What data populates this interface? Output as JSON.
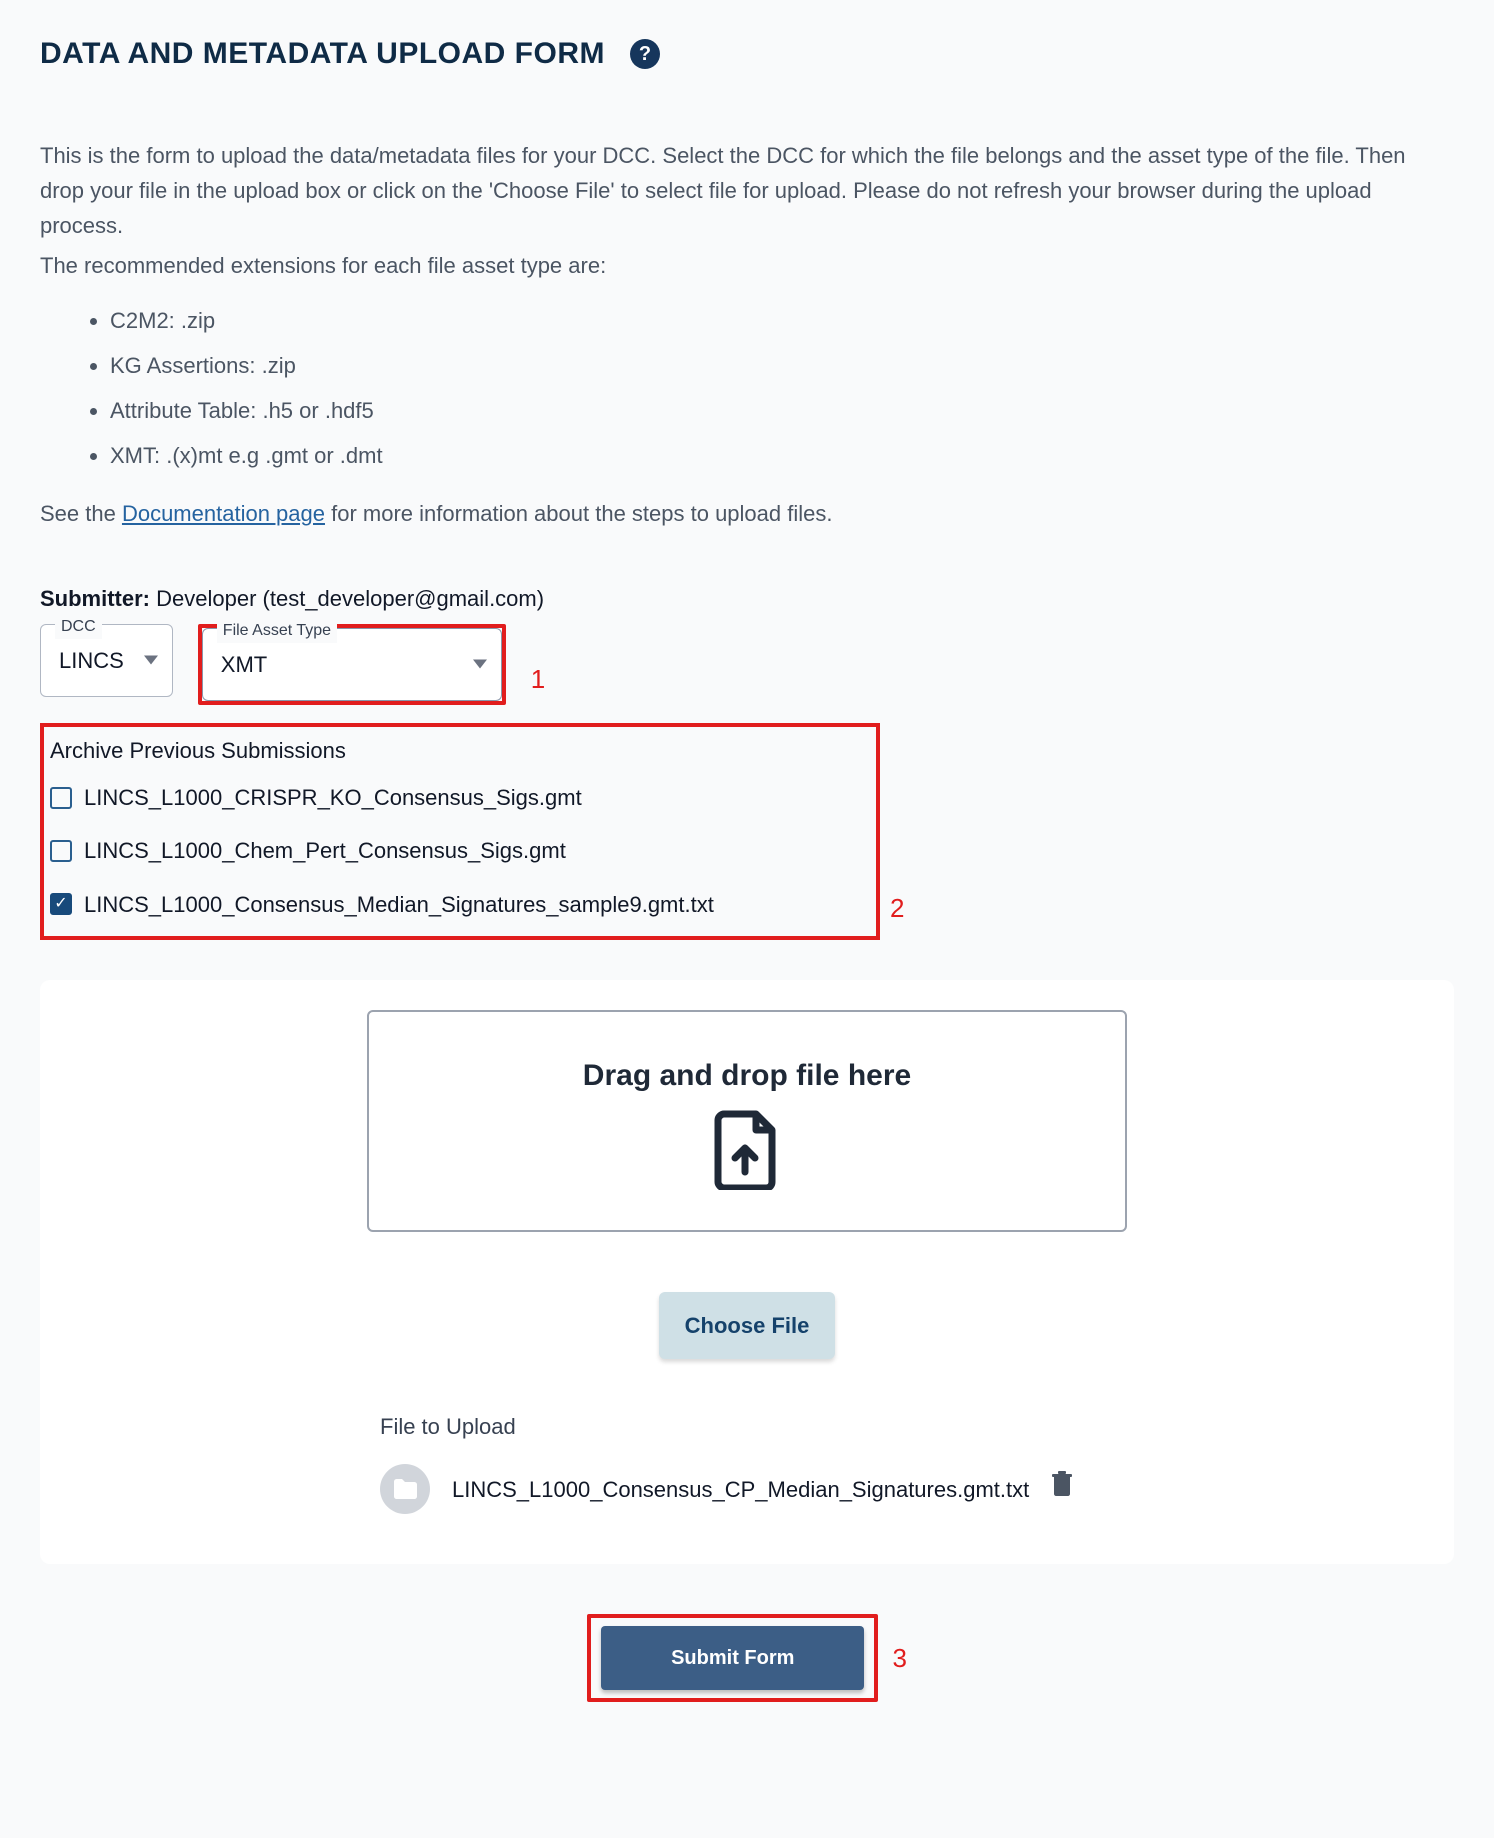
{
  "title": "DATA AND METADATA UPLOAD FORM",
  "intro": {
    "p1": "This is the form to upload the data/metadata files for your DCC. Select the DCC for which the file belongs and the asset type of the file. Then drop your file in the upload box or click on the 'Choose File' to select file for upload. Please do not refresh your browser during the upload process.",
    "p2": "The recommended extensions for each file asset type are:"
  },
  "extensions": [
    "C2M2: .zip",
    "KG Assertions: .zip",
    "Attribute Table: .h5 or .hdf5",
    "XMT: .(x)mt e.g .gmt or .dmt"
  ],
  "doc_prefix": "See the ",
  "doc_link_text": "Documentation page",
  "doc_suffix": " for more information about the steps to upload files.",
  "submitter": {
    "label": "Submitter:",
    "value": "Developer (test_developer@gmail.com)"
  },
  "selects": {
    "dcc": {
      "legend": "DCC",
      "value": "LINCS"
    },
    "asset": {
      "legend": "File Asset Type",
      "value": "XMT"
    }
  },
  "annotations": {
    "a1": "1",
    "a2": "2",
    "a3": "3"
  },
  "archive": {
    "title": "Archive Previous Submissions",
    "items": [
      {
        "label": "LINCS_L1000_CRISPR_KO_Consensus_Sigs.gmt",
        "checked": false
      },
      {
        "label": "LINCS_L1000_Chem_Pert_Consensus_Sigs.gmt",
        "checked": false
      },
      {
        "label": "LINCS_L1000_Consensus_Median_Signatures_sample9.gmt.txt",
        "checked": true
      }
    ]
  },
  "dropzone_text": "Drag and drop file here",
  "choose_file_label": "Choose File",
  "file_to_upload_label": "File to Upload",
  "uploaded_file_name": "LINCS_L1000_Consensus_CP_Median_Signatures.gmt.txt",
  "submit_label": "Submit Form"
}
